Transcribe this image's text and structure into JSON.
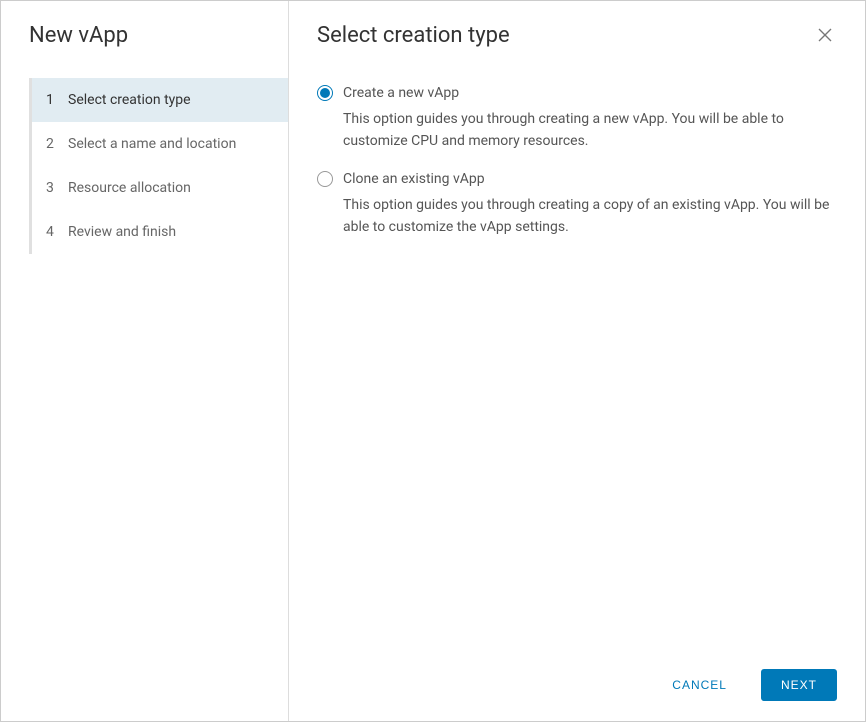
{
  "sidebar": {
    "title": "New vApp",
    "steps": [
      {
        "number": "1",
        "label": "Select creation type",
        "active": true
      },
      {
        "number": "2",
        "label": "Select a name and location",
        "active": false
      },
      {
        "number": "3",
        "label": "Resource allocation",
        "active": false
      },
      {
        "number": "4",
        "label": "Review and finish",
        "active": false
      }
    ]
  },
  "main": {
    "title": "Select creation type",
    "options": [
      {
        "label": "Create a new vApp",
        "description": "This option guides you through creating a new vApp. You will be able to customize CPU and memory resources.",
        "selected": true
      },
      {
        "label": "Clone an existing vApp",
        "description": "This option guides you through creating a copy of an existing vApp. You will be able to customize the vApp settings.",
        "selected": false
      }
    ]
  },
  "footer": {
    "cancel": "CANCEL",
    "next": "NEXT"
  }
}
